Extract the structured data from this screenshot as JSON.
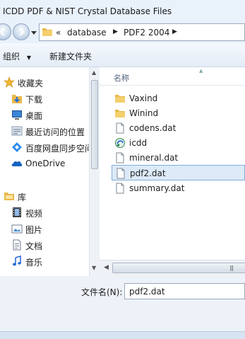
{
  "window": {
    "title": "ICDD PDF & NIST Crystal Database Files"
  },
  "address": {
    "overflow": "«",
    "crumbs": [
      "database",
      "PDF2 2004"
    ]
  },
  "toolbar": {
    "organize": "组织",
    "new_folder": "新建文件夹"
  },
  "nav": {
    "favorites": "收藏夹",
    "downloads": "下载",
    "desktop": "桌面",
    "recent": "最近访问的位置",
    "baidu": "百度网盘同步空间",
    "onedrive": "OneDrive",
    "libraries": "库",
    "videos": "视频",
    "pictures": "图片",
    "documents": "文档",
    "music": "音乐"
  },
  "files": {
    "column_name": "名称",
    "items": [
      {
        "name": "Vaxind",
        "type": "folder"
      },
      {
        "name": "Winind",
        "type": "folder"
      },
      {
        "name": "codens.dat",
        "type": "file"
      },
      {
        "name": "icdd",
        "type": "app"
      },
      {
        "name": "mineral.dat",
        "type": "file"
      },
      {
        "name": "pdf2.dat",
        "type": "file",
        "selected": true
      },
      {
        "name": "summary.dat",
        "type": "file"
      }
    ]
  },
  "filename": {
    "label": "文件名(N):",
    "value": "pdf2.dat"
  },
  "colors": {
    "accent": "#84acd9",
    "selection": "#dceaf8",
    "folder": "#e8b84a"
  }
}
